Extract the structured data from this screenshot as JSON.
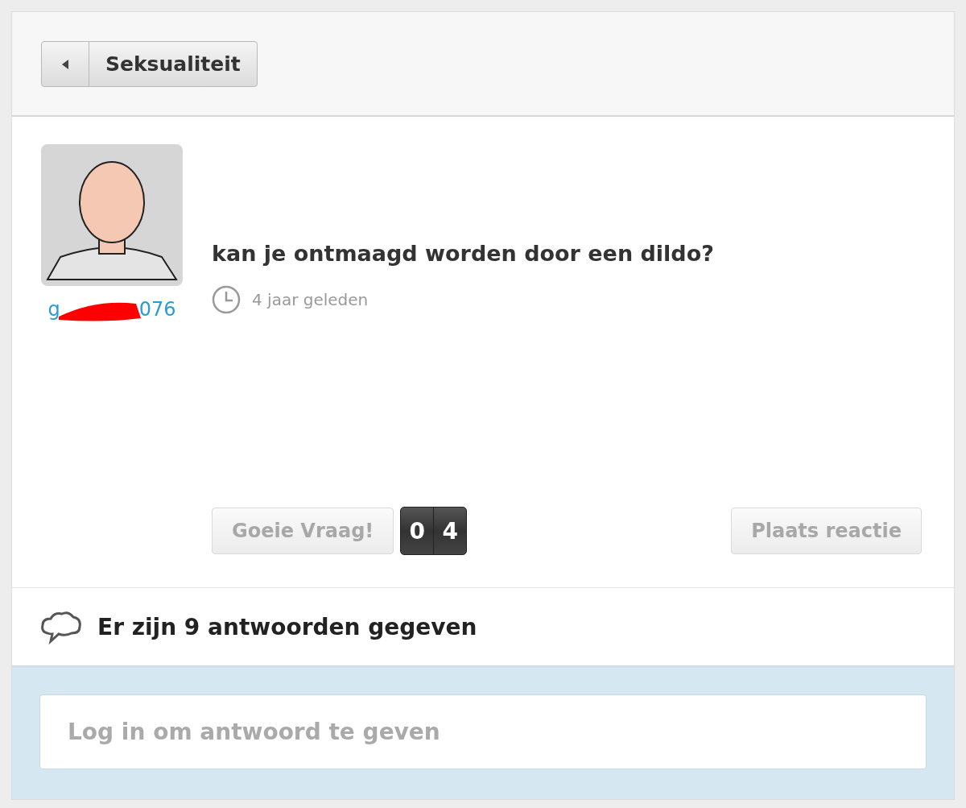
{
  "back_button": {
    "label": "Seksualiteit"
  },
  "question": {
    "author_fragments": [
      "g",
      "076"
    ],
    "title": "kan je ontmaagd worden door een dildo?",
    "time": "4 jaar geleden"
  },
  "vote": {
    "label": "Goeie Vraag!",
    "disabled": true,
    "counter_digits": [
      "0",
      "4"
    ]
  },
  "reply_button": {
    "label": "Plaats reactie",
    "disabled": true
  },
  "answers": {
    "summary": "Er zijn 9 antwoorden gegeven"
  },
  "answer_field": {
    "placeholder": "Log in om antwoord te geven"
  }
}
